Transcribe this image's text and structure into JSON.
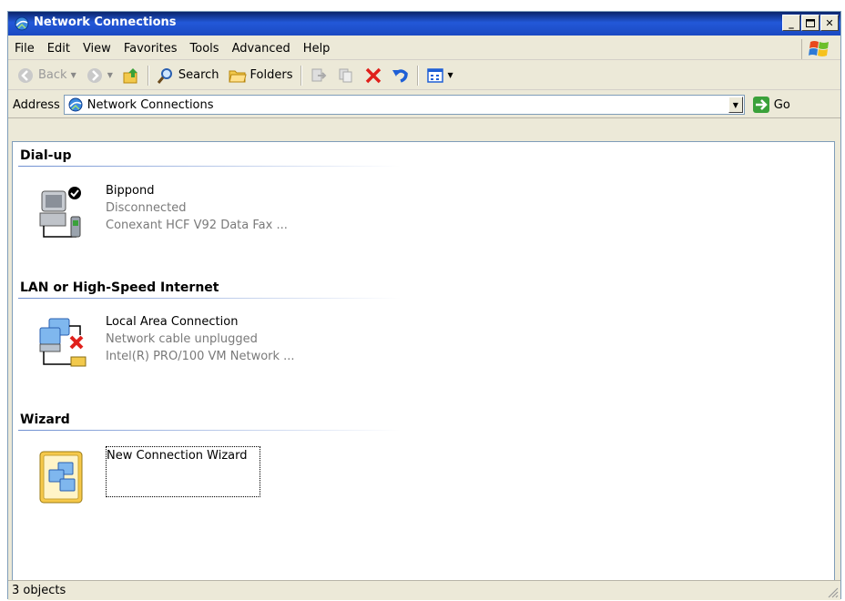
{
  "window": {
    "title": "Network Connections"
  },
  "menu": [
    "File",
    "Edit",
    "View",
    "Favorites",
    "Tools",
    "Advanced",
    "Help"
  ],
  "toolbar": {
    "back": "Back",
    "search": "Search",
    "folders": "Folders"
  },
  "address": {
    "label": "Address",
    "value": "Network Connections",
    "go": "Go"
  },
  "groups": {
    "dialup": {
      "header": "Dial-up",
      "item": {
        "name": "Bippond",
        "status": "Disconnected",
        "device": "Conexant HCF V92 Data Fax ..."
      }
    },
    "lan": {
      "header": "LAN or High-Speed Internet",
      "item": {
        "name": "Local Area Connection",
        "status": "Network cable unplugged",
        "device": "Intel(R) PRO/100 VM Network ..."
      }
    },
    "wizard": {
      "header": "Wizard",
      "item": {
        "name": "New Connection Wizard"
      }
    }
  },
  "status": {
    "text": "3 objects"
  }
}
